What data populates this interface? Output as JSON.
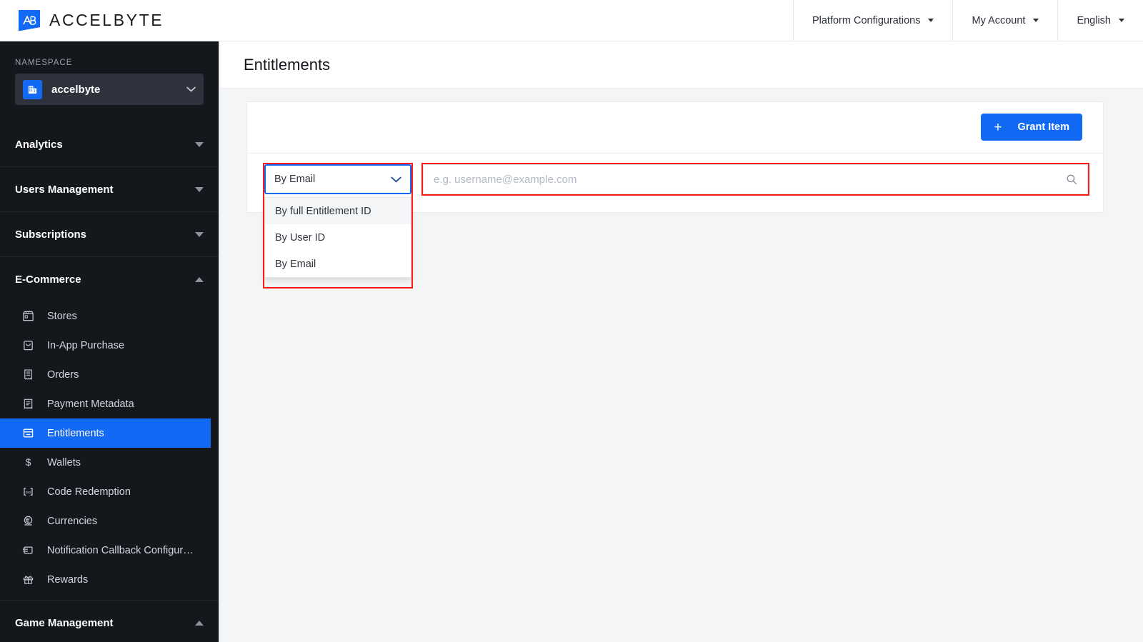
{
  "header": {
    "brand_name": "ACCELBYTE",
    "brand_icon": "accelbyte-logo-icon",
    "nav": [
      {
        "label": "Platform Configurations",
        "icon": "chevron-down-icon"
      },
      {
        "label": "My Account",
        "icon": "chevron-down-icon"
      },
      {
        "label": "English",
        "icon": "chevron-down-icon"
      }
    ]
  },
  "sidebar": {
    "namespace_label": "NAMESPACE",
    "namespace_value": "accelbyte",
    "namespace_icon": "building-icon",
    "namespace_chevron": "chevron-down-icon",
    "sections": [
      {
        "label": "Analytics",
        "state": "collapsed",
        "icon": "triangle-down-icon",
        "items": []
      },
      {
        "label": "Users Management",
        "state": "collapsed",
        "icon": "triangle-down-icon",
        "items": []
      },
      {
        "label": "Subscriptions",
        "state": "collapsed",
        "icon": "triangle-down-icon",
        "items": []
      },
      {
        "label": "E-Commerce",
        "state": "expanded",
        "icon": "triangle-up-icon",
        "items": [
          {
            "label": "Stores",
            "icon": "store-icon",
            "active": false
          },
          {
            "label": "In-App Purchase",
            "icon": "shopping-bag-icon",
            "active": false
          },
          {
            "label": "Orders",
            "icon": "receipt-icon",
            "active": false
          },
          {
            "label": "Payment Metadata",
            "icon": "document-lines-icon",
            "active": false
          },
          {
            "label": "Entitlements",
            "icon": "entitlement-card-icon",
            "active": true
          },
          {
            "label": "Wallets",
            "icon": "dollar-icon",
            "active": false
          },
          {
            "label": "Code Redemption",
            "icon": "code-bracket-icon",
            "active": false
          },
          {
            "label": "Currencies",
            "icon": "currency-euro-icon",
            "active": false
          },
          {
            "label": "Notification Callback Configur…",
            "icon": "callback-card-icon",
            "active": false
          },
          {
            "label": "Rewards",
            "icon": "gift-icon",
            "active": false
          }
        ]
      },
      {
        "label": "Game Management",
        "state": "expanded",
        "icon": "triangle-up-icon",
        "items": []
      }
    ]
  },
  "main": {
    "page_title": "Entitlements",
    "grant_button": {
      "label": "Grant Item",
      "icon": "plus-icon"
    },
    "filter_select": {
      "selected": "By Email",
      "chevron_icon": "chevron-down-icon",
      "open": true,
      "options": [
        {
          "label": "By full Entitlement ID",
          "highlighted": true
        },
        {
          "label": "By User ID",
          "highlighted": false
        },
        {
          "label": "By Email",
          "highlighted": false
        }
      ]
    },
    "search": {
      "value": "",
      "placeholder": "e.g. username@example.com",
      "icon": "search-icon"
    }
  },
  "colors": {
    "accent_blue": "#1269f3",
    "sidebar_bg": "#14171c",
    "namespace_bg": "#2e323c",
    "annotation_red": "#f81b16",
    "page_bg": "#f4f5f7"
  }
}
